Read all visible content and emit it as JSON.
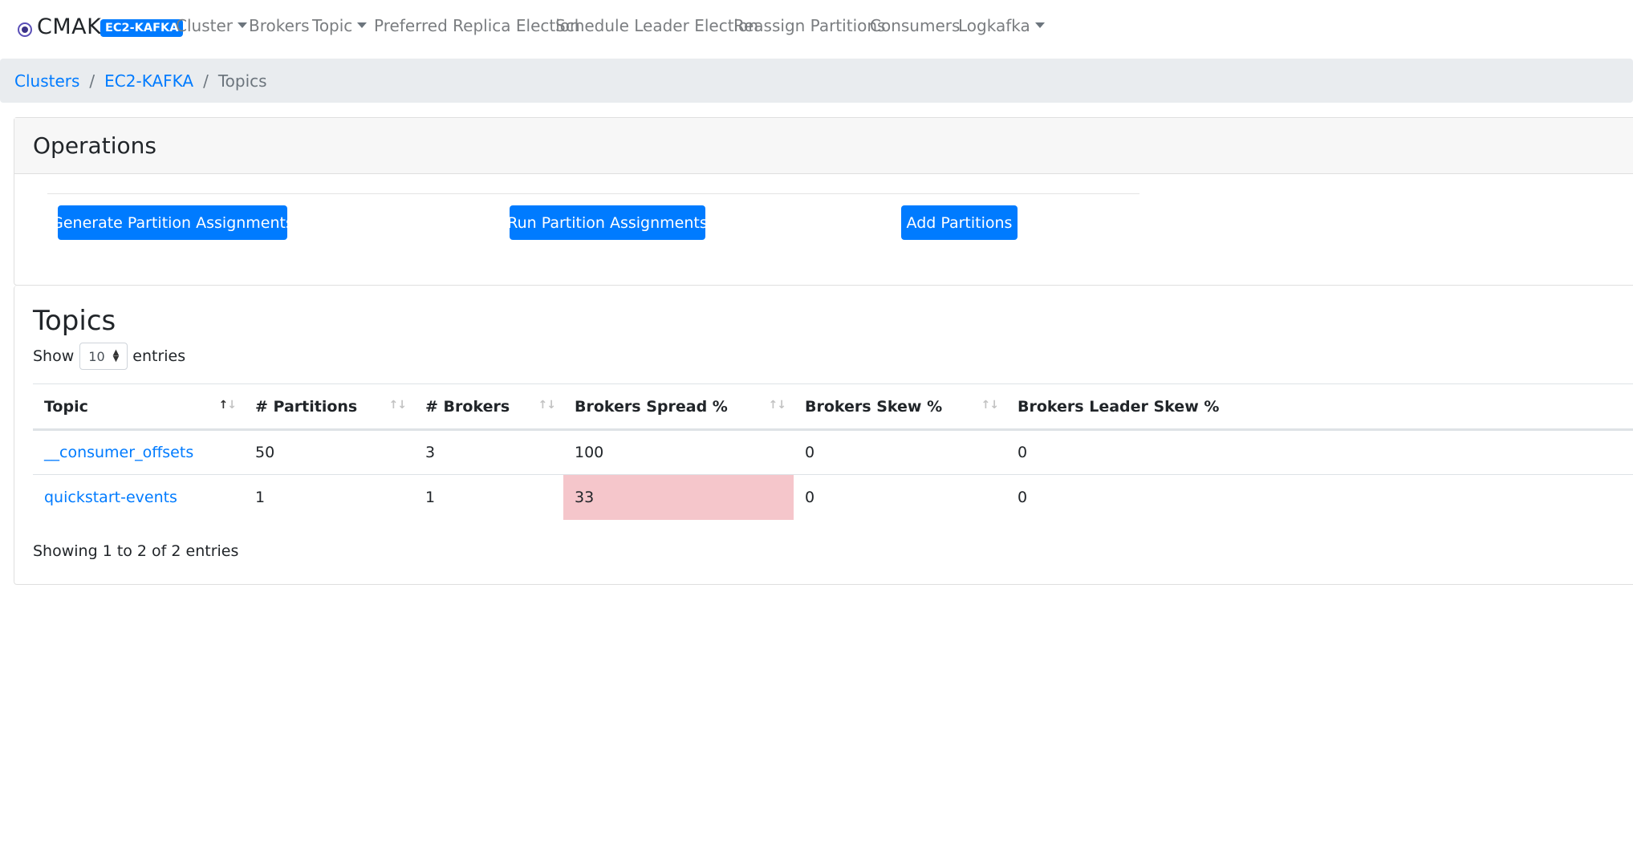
{
  "brand": {
    "name": "CMAK",
    "icon": "kafka-manager-logo-icon"
  },
  "cluster_badge": "EC2-KAFKA",
  "nav": {
    "items": [
      {
        "label": "Cluster",
        "dropdown": true
      },
      {
        "label": "Brokers",
        "dropdown": false
      },
      {
        "label": "Topic",
        "dropdown": true
      },
      {
        "label": "Preferred Replica Election",
        "dropdown": false
      },
      {
        "label": "Schedule Leader Election",
        "dropdown": false
      },
      {
        "label": "Reassign Partitions",
        "dropdown": false
      },
      {
        "label": "Consumers",
        "dropdown": false
      },
      {
        "label": "Logkafka",
        "dropdown": true
      }
    ]
  },
  "breadcrumb": {
    "items": [
      "Clusters",
      "EC2-KAFKA"
    ],
    "active": "Topics",
    "separator": "/"
  },
  "operations": {
    "title": "Operations",
    "buttons": {
      "generate": "Generate Partition Assignments",
      "run": "Run Partition Assignments",
      "add": "Add Partitions"
    }
  },
  "topics": {
    "title": "Topics",
    "show_label": "Show",
    "page_size": "10",
    "entries_label": "entries",
    "columns": [
      "Topic",
      "# Partitions",
      "# Brokers",
      "Brokers Spread %",
      "Brokers Skew %",
      "Brokers Leader Skew %"
    ],
    "rows": [
      {
        "topic": "__consumer_offsets",
        "partitions": "50",
        "brokers": "3",
        "spread": "100",
        "skew": "0",
        "leader_skew": "0",
        "spread_alert": false
      },
      {
        "topic": "quickstart-events",
        "partitions": "1",
        "brokers": "1",
        "spread": "33",
        "skew": "0",
        "leader_skew": "0",
        "spread_alert": true
      }
    ],
    "footer": "Showing 1 to 2 of 2 entries",
    "colors": {
      "alert_cell": "#f5c6cb",
      "link": "#007bff",
      "primary_button": "#007bff"
    }
  }
}
